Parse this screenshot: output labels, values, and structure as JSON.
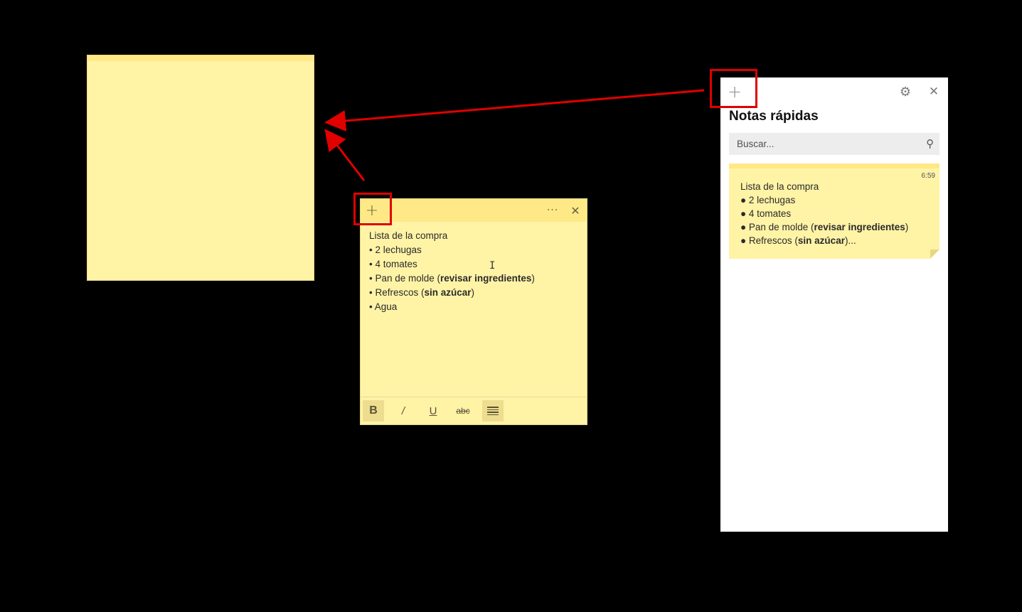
{
  "note_window": {
    "plus_glyph": "+",
    "more_glyph": "···",
    "close_glyph": "✕",
    "lines": [
      {
        "prefix": "Lista de la compra",
        "bold": "",
        "suffix": ""
      },
      {
        "prefix": "• 2 lechugas",
        "bold": "",
        "suffix": ""
      },
      {
        "prefix": "• 4 tomates",
        "bold": "",
        "suffix": ""
      },
      {
        "prefix": "• Pan de molde (",
        "bold": "revisar ingredientes",
        "suffix": ")"
      },
      {
        "prefix": "• Refrescos (",
        "bold": "sin azúcar",
        "suffix": ")"
      },
      {
        "prefix": "• Agua",
        "bold": "",
        "suffix": ""
      }
    ],
    "format_bar": {
      "bold": "B",
      "italic": "/",
      "underline": "U",
      "strike": "abc"
    }
  },
  "panel": {
    "title": "Notas rápidas",
    "plus_glyph": "+",
    "gear_glyph": "⚙",
    "close_glyph": "✕",
    "search": {
      "placeholder": "Buscar..."
    },
    "note_card": {
      "time": "6:59",
      "lines": [
        {
          "prefix": "Lista de la compra",
          "bold": "",
          "suffix": ""
        },
        {
          "prefix": "● 2 lechugas",
          "bold": "",
          "suffix": ""
        },
        {
          "prefix": "● 4 tomates",
          "bold": "",
          "suffix": ""
        },
        {
          "prefix": "● Pan de molde (",
          "bold": "revisar ingredientes",
          "suffix": ")"
        },
        {
          "prefix": "● Refrescos (",
          "bold": "sin azúcar",
          "suffix": ")..."
        }
      ]
    }
  },
  "colors": {
    "background": "#000000",
    "note_body": "#FFF3A6",
    "note_header": "#FFE986",
    "annotation_red": "#E00000"
  },
  "icons": {
    "new_note": "plus-icon",
    "more": "more-icon",
    "close": "close-icon",
    "settings": "gear-icon",
    "search": "search-icon",
    "bullets": "list-icon"
  }
}
